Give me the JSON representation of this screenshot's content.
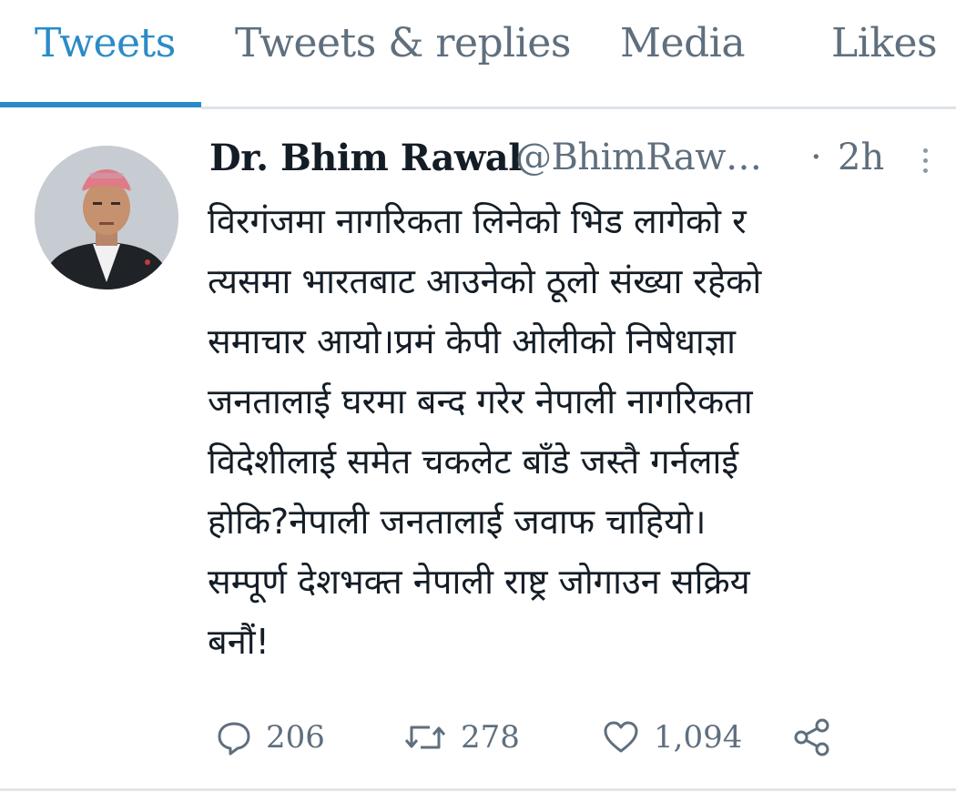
{
  "tabs": {
    "tweets": "Tweets",
    "replies": "Tweets & replies",
    "media": "Media",
    "likes": "Likes",
    "active": "Tweets"
  },
  "tweet": {
    "author_name": "Dr. Bhim Rawal",
    "author_handle": "@BhimRaw…",
    "separator": "·",
    "time": "2h",
    "text": "विरगंजमा नागरिकता लिनेको भिड लागेको र\nत्यसमा भारतबाट आउनेको ठूलो संख्या रहेको\nसमाचार आयो।प्रमं केपी ओलीको निषेधाज्ञा\nजनतालाई घरमा बन्द गरेर नेपाली नागरिकता\nविदेशीलाई समेत चकलेट बाँडे जस्तै गर्नलाई\nहोकि?नेपाली जनतालाई जवाफ चाहियो।\nसम्पूर्ण देशभक्त नेपाली राष्ट्र जोगाउन सक्रिय\nबनौं!",
    "actions": {
      "replies": "206",
      "retweets": "278",
      "likes": "1,094"
    }
  },
  "icons": {
    "reply": "reply-icon",
    "retweet": "retweet-icon",
    "like": "heart-icon",
    "share": "share-icon",
    "more": "more-vertical-icon"
  },
  "colors": {
    "accent": "#2b8bc7",
    "secondary_text": "#5f6f7e",
    "primary_text": "#141d26",
    "divider": "#dde3e8"
  }
}
